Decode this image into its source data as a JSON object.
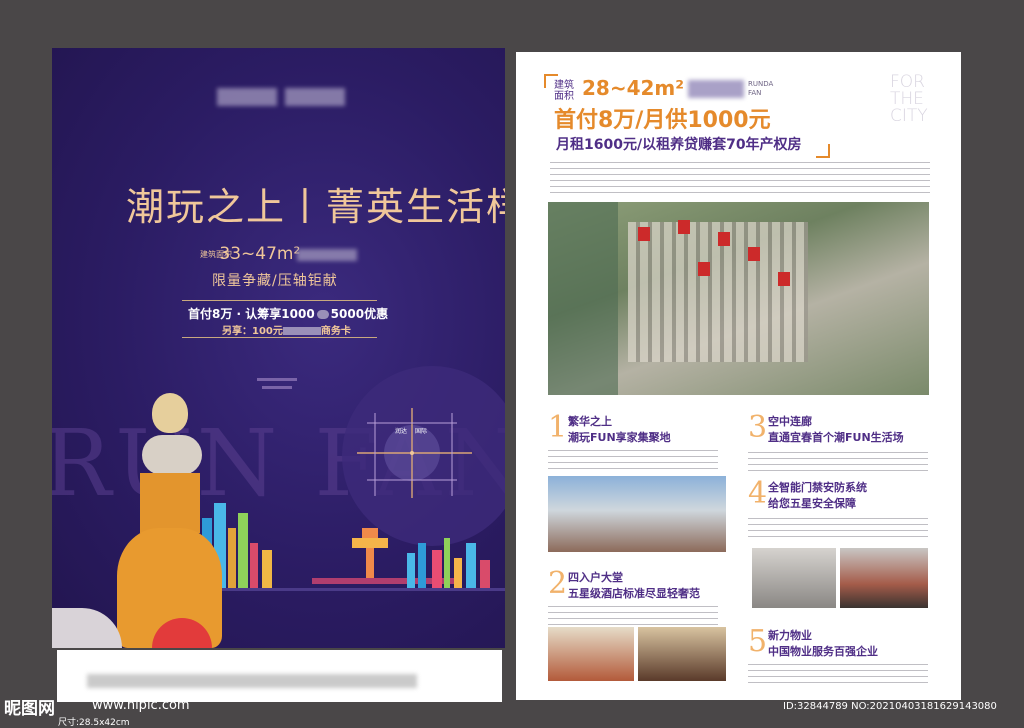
{
  "left_flyer": {
    "headline": "潮玩之上丨菁英生活样本",
    "area_label": "建筑面积",
    "area_value": "33~47m²",
    "slogan": "限量争藏/压轴钜献",
    "offer_line1_a": "首付8万 · 认筹享1000",
    "offer_line1_b": "5000优惠",
    "offer_line2_a": "另享：100元",
    "offer_line2_b": "商务卡",
    "map_label_1": "润达",
    "map_label_2": "国际",
    "bg_letters": "RUN FANG"
  },
  "right_flyer": {
    "area_label": "建筑面积",
    "area_value": "28~42m²",
    "brand": "RUNDA FAN",
    "headline": "首付8万/月供1000元",
    "subheadline": "月租1600元/以租养贷赚套70年产权房",
    "watermark": [
      "FOR",
      "THE",
      "CITY"
    ],
    "features": [
      {
        "num": "1",
        "line1": "繁华之上",
        "line2": "潮玩FUN享家集聚地"
      },
      {
        "num": "2",
        "line1": "四入户大堂",
        "line2": "五星级酒店标准尽显轻奢范"
      },
      {
        "num": "3",
        "line1": "空中连廊",
        "line2": "直通宜春首个潮FUN生活场"
      },
      {
        "num": "4",
        "line1": "全智能门禁安防系统",
        "line2": "给您五星安全保障"
      },
      {
        "num": "5",
        "line1": "新力物业",
        "line2": "中国物业服务百强企业"
      }
    ]
  },
  "footer": {
    "logo": "昵图网",
    "url": "www.nipic.com",
    "size": "尺寸:28.5x42cm",
    "id": "ID:32844789 NO:20210403181629143080"
  },
  "colors": {
    "left_bg": "#2b1c63",
    "gold": "#f0c79a",
    "purple": "#4f2e86",
    "orange": "#e58a2b",
    "frame": "#4a4748"
  }
}
